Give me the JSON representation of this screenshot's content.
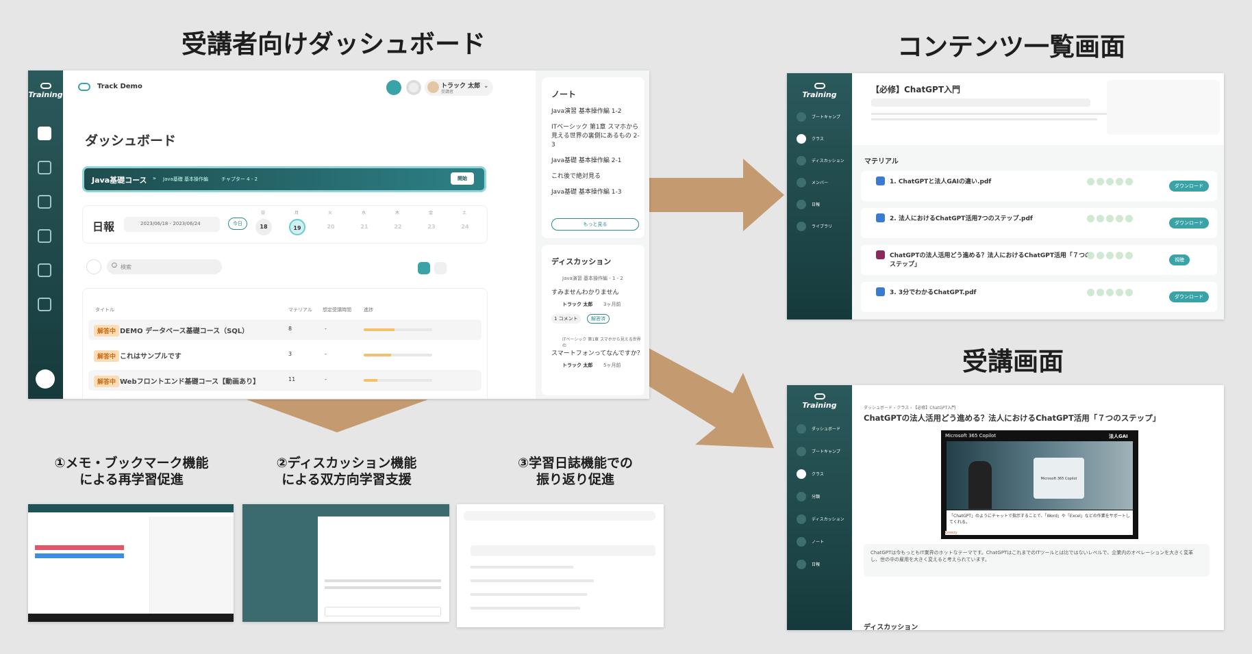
{
  "headings": {
    "dashboard": "受講者向けダッシュボード",
    "contents": "コンテンツ一覧画面",
    "lecture": "受講画面"
  },
  "features": [
    {
      "line1": "①メモ・ブックマーク機能",
      "line2": "による再学習促進"
    },
    {
      "line1": "②ディスカッション機能",
      "line2": "による双方向学習支援"
    },
    {
      "line1": "③学習日誌機能での",
      "line2": "振り返り促進"
    }
  ],
  "colors": {
    "brand": "#1e5457",
    "accent": "#3aa3a8",
    "arrow": "#c49a70"
  },
  "dashboard": {
    "logo": "Training",
    "app_name": "Track Demo",
    "user_name": "トラック 太郎",
    "user_role": "受講者",
    "title": "ダッシュボード",
    "course_banner": {
      "course": "Java基礎コース",
      "sep": "»",
      "part": "Java基礎 基本操作編",
      "chapter": "チャプター 4 - 2",
      "button": "開始"
    },
    "daily": {
      "label": "日報",
      "range": "2023/06/18 - 2023/06/24",
      "today": "今日",
      "days": [
        {
          "w": "日",
          "d": "18"
        },
        {
          "w": "月",
          "d": "19"
        },
        {
          "w": "火",
          "d": "20"
        },
        {
          "w": "水",
          "d": "21"
        },
        {
          "w": "木",
          "d": "22"
        },
        {
          "w": "金",
          "d": "23"
        },
        {
          "w": "土",
          "d": "24"
        }
      ]
    },
    "search_placeholder": "検索",
    "table": {
      "headers": [
        "タイトル",
        "マテリアル",
        "想定受講時間",
        "進捗"
      ],
      "rows": [
        {
          "status": "解答中",
          "title": "DEMO データベース基礎コース（SQL）",
          "materials": "8",
          "time": "-",
          "progress": 0.45
        },
        {
          "status": "解答中",
          "title": "これはサンプルです",
          "materials": "3",
          "time": "-",
          "progress": 0.4
        },
        {
          "status": "解答中",
          "title": "Webフロントエンド基礎コース【動画あり】",
          "materials": "11",
          "time": "-",
          "progress": 0.2
        }
      ]
    },
    "notes": {
      "title": "ノート",
      "items": [
        "Java演習 基本操作編 1-2",
        "ITベーシック 第1章 スマホから見える世界の裏側にあるもの 2-3",
        "Java基礎 基本操作編 2-1",
        "これ後で絶対見る",
        "Java基礎 基本操作編 1-3"
      ],
      "more": "もっと見る"
    },
    "discussion": {
      "title": "ディスカッション",
      "items": [
        {
          "source": "Java演習 基本操作編 - 1 - 2",
          "text": "すみませんわかりません",
          "user": "トラック 太郎",
          "time": "3ヶ月前",
          "comments": "1 コメント",
          "solved": "解答済"
        },
        {
          "source": "ITベーシック 第1章 スマホから見える世界の",
          "text": "スマートフォンってなんですか？",
          "user": "トラック 太郎",
          "time": "5ヶ月前"
        }
      ]
    }
  },
  "contents": {
    "logo": "Training",
    "nav": [
      "ブートキャンプ",
      "クラス",
      "ディスカッション",
      "メンバー",
      "日報",
      "ライブラリ"
    ],
    "title": "【必修】ChatGPT入門",
    "section": "マテリアル",
    "materials": [
      {
        "title": "1. ChatGPTと法人GAIの違い.pdf",
        "button": "ダウンロード"
      },
      {
        "title": "2. 法人におけるChatGPT活用7つのステップ.pdf",
        "button": "ダウンロード"
      },
      {
        "title": "ChatGPTの法人活用どう進める？法人におけるChatGPT活用「７つのステップ」",
        "button": "視聴"
      },
      {
        "title": "3. 3分でわかるChatGPT.pdf",
        "button": "ダウンロード"
      }
    ]
  },
  "lecture": {
    "logo": "Training",
    "nav": [
      "ダッシュボード",
      "ブートキャンプ",
      "クラス",
      "分類",
      "ディスカッション",
      "ノート",
      "日報"
    ],
    "breadcrumb": "ダッシュボード › クラス › 【必修】ChatGPT入門",
    "title": "ChatGPTの法人活用どう進める？法人におけるChatGPT活用「７つのステップ」",
    "video_header": "Microsoft 365 Copilot",
    "video_badge": "法人GAI",
    "video_inner": "Microsoft 365 Copilot",
    "video_caption": "「ChatGPT」のようにチャットで指示することで、「Word」や「Excel」などの作業をサポートしてくれる。",
    "video_brand": "Greezy",
    "description": "ChatGPTは今もっともIT業界のホットなテーマです。ChatGPTはこれまでのITツールとは比ではないレベルで、企業内のオペレーションを大きく変革し、世の中の雇用を大きく変えると考えられています。",
    "discussion": "ディスカッション"
  }
}
